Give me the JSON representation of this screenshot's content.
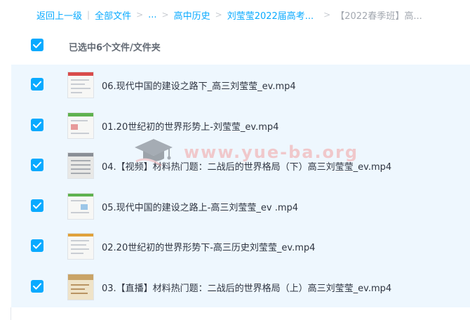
{
  "breadcrumb": {
    "back": "返回上一级",
    "all_files": "全部文件",
    "ellipsis": "...",
    "subject": "高中历史",
    "course": "刘莹莹2022届高考...",
    "current": "【2022春季班】高..."
  },
  "selection": {
    "summary": "已选中6个文件/文件夹",
    "all_checked": true
  },
  "files": [
    {
      "name": "06.现代中国的建设之路下_高三刘莹莹_ev.mp4",
      "checked": true,
      "thumb_accent": "#d94b4b"
    },
    {
      "name": "01.20世纪初的世界形势上-刘莹莹_ev.mp4",
      "checked": true,
      "thumb_accent": "#5fb24f"
    },
    {
      "name": "04.【视频】材料热门题：二战后的世界格局（下）高三刘莹莹_ev.mp4",
      "checked": true,
      "thumb_accent": "#8a8f96"
    },
    {
      "name": "05.现代中国的建设之路上-高三刘莹莹_ev .mp4",
      "checked": true,
      "thumb_accent": "#5fb24f"
    },
    {
      "name": "02.20世纪初的世界形势下-高三历史刘莹莹_ev.mp4",
      "checked": true,
      "thumb_accent": "#e0a23a"
    },
    {
      "name": "03.【直播】材料热门题：二战后的世界格局（上）高三刘莹莹_ev.mp4",
      "checked": true,
      "thumb_accent": "#c9a467"
    }
  ],
  "watermark": {
    "text": "www.yue-ba.org",
    "icon": "graduation-cap-icon"
  },
  "colors": {
    "accent": "#09aaff",
    "list_bg": "#eef7fe",
    "watermark": "#f2a3a3"
  }
}
